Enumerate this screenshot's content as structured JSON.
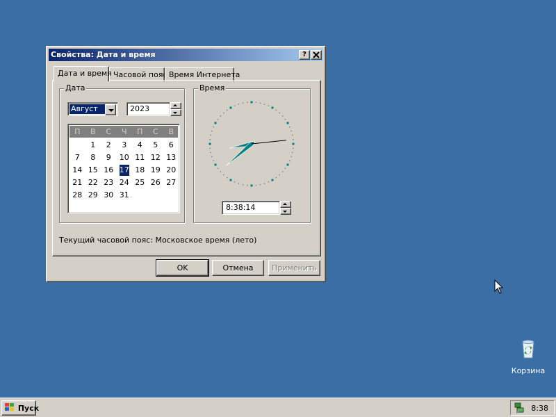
{
  "dialog": {
    "title": "Свойства: Дата и время",
    "help_btn": "?",
    "close_btn": "✕",
    "tabs": [
      {
        "label": "Дата и время",
        "active": true
      },
      {
        "label": "Часовой пояс",
        "active": false
      },
      {
        "label": "Время Интернета",
        "active": false
      }
    ],
    "date_group": {
      "label": "Дата",
      "month": "Август",
      "year": "2023",
      "weekdays": [
        "П",
        "В",
        "С",
        "Ч",
        "П",
        "С",
        "В"
      ],
      "leading_blanks": 1,
      "days": [
        "1",
        "2",
        "3",
        "4",
        "5",
        "6",
        "7",
        "8",
        "9",
        "10",
        "11",
        "12",
        "13",
        "14",
        "15",
        "16",
        "17",
        "18",
        "19",
        "20",
        "21",
        "22",
        "23",
        "24",
        "25",
        "26",
        "27",
        "28",
        "29",
        "30",
        "31"
      ],
      "selected_day": "17"
    },
    "time_group": {
      "label": "Время",
      "time": "8:38:14",
      "hour": 8,
      "minute": 38,
      "second": 14
    },
    "timezone_text": "Текущий часовой пояс: Московское время (лето)",
    "buttons": {
      "ok": "OK",
      "cancel": "Отмена",
      "apply": "Применить"
    }
  },
  "desktop": {
    "recycle_bin_label": "Корзина"
  },
  "taskbar": {
    "start_label": "Пуск",
    "clock": "8:38"
  },
  "colors": {
    "desktop": "#3a6ea5",
    "selection": "#0a246a",
    "clock_marks": "#008080"
  }
}
